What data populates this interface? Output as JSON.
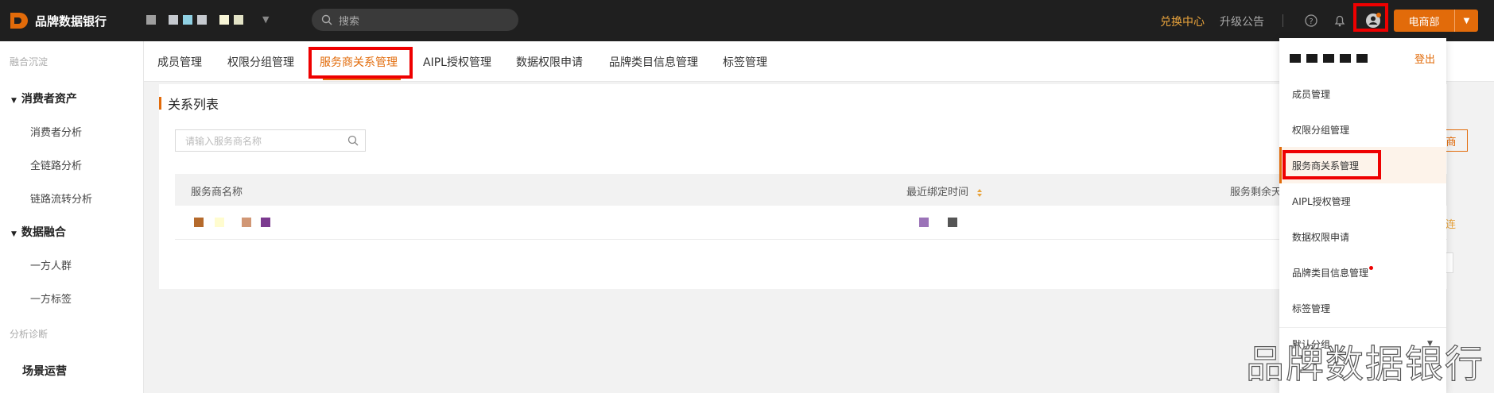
{
  "app": {
    "name": "品牌数据银行"
  },
  "topbar": {
    "search_placeholder": "搜索",
    "exchange": "兑换中心",
    "upgrade": "升级公告",
    "department": "电商部",
    "workspace_colors": [
      "#9e9e9e",
      "#c5c9cf",
      "#8fd0e3",
      "#f7f5d6",
      "#e3e3c6"
    ]
  },
  "sidebar": {
    "groups": [
      {
        "label": "融合沉淀"
      },
      {
        "label": "分析诊断"
      }
    ],
    "sections": [
      {
        "label": "消费者资产",
        "items": [
          "消费者分析",
          "全链路分析",
          "链路流转分析"
        ]
      },
      {
        "label": "数据融合",
        "items": [
          "一方人群",
          "一方标签"
        ]
      }
    ],
    "bottom_item": "场景运营"
  },
  "tabs": [
    "成员管理",
    "权限分组管理",
    "服务商关系管理",
    "AIPL授权管理",
    "数据权限申请",
    "品牌类目信息管理",
    "标签管理"
  ],
  "active_tab": "服务商关系管理",
  "content": {
    "title": "关系列表",
    "filter_placeholder": "请输入服务商名称",
    "add_button_fragment": "商",
    "columns": [
      "服务商名称",
      "最近绑定时间",
      "服务剩余天"
    ],
    "op_fragment": "连",
    "row_masks": [
      "#b56a2c",
      "#fffccf",
      "#d19775",
      "#7b3a8f",
      "#9b73b8",
      "#555555"
    ]
  },
  "user_menu": {
    "logout": "登出",
    "items": [
      "成员管理",
      "权限分组管理",
      "服务商关系管理",
      "AIPL授权管理",
      "数据权限申请",
      "品牌类目信息管理",
      "标签管理"
    ],
    "active_item": "服务商关系管理",
    "group_label": "默认分组"
  },
  "watermark": "品牌数据银行",
  "colors": {
    "accent": "#e26b0a",
    "highlight": "#ee0000",
    "topbar": "#1f1f1f"
  }
}
